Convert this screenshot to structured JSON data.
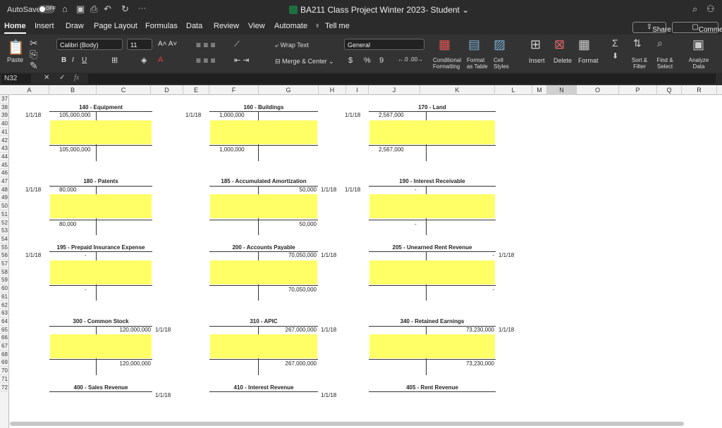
{
  "titlebar": {
    "autosave_label": "AutoSave",
    "autosave_state": "OFF",
    "doc_title": "BA211 Class Project Winter 2023- Student",
    "more": "···"
  },
  "tabs": [
    "Home",
    "Insert",
    "Draw",
    "Page Layout",
    "Formulas",
    "Data",
    "Review",
    "View",
    "Automate"
  ],
  "tell_me": "Tell me",
  "share": "Share",
  "comments": "Comments",
  "ribbon": {
    "paste": "Paste",
    "font": "Calibri (Body)",
    "size": "11",
    "bold": "B",
    "italic": "I",
    "underline": "U",
    "wrap": "Wrap Text",
    "merge": "Merge & Center",
    "number_format": "General",
    "dollar": "$",
    "percent": "%",
    "comma": "9",
    "cond": "Conditional Formatting",
    "format_table": "Format as Table",
    "cell_styles": "Cell Styles",
    "insert": "Insert",
    "delete": "Delete",
    "format": "Format",
    "sort": "Sort & Filter",
    "find": "Find & Select",
    "analyze": "Analyze Data"
  },
  "formula_bar": {
    "name": "N32",
    "fx": "fx",
    "value": ""
  },
  "columns": [
    "A",
    "B",
    "C",
    "D",
    "E",
    "F",
    "G",
    "H",
    "I",
    "J",
    "K",
    "L",
    "M",
    "N",
    "O",
    "P",
    "Q",
    "R"
  ],
  "rows": [
    "37",
    "38",
    "39",
    "40",
    "41",
    "42",
    "43",
    "44",
    "45",
    "46",
    "47",
    "48",
    "49",
    "50",
    "51",
    "52",
    "53",
    "54",
    "55",
    "56",
    "57",
    "58",
    "59",
    "60",
    "61",
    "62",
    "63",
    "64",
    "65",
    "66",
    "67",
    "68",
    "69",
    "70",
    "71",
    "72"
  ],
  "accounts": [
    {
      "title": "140 - Equipment",
      "date_left": "1/1/18",
      "debit": "105,000,000",
      "credit": "",
      "date_right": "",
      "total_left": "105,000,000",
      "total_right": ""
    },
    {
      "title": "160 - Buildings",
      "date_left": "1/1/18",
      "debit": "1,000,000",
      "credit": "",
      "date_right": "",
      "total_left": "1,000,000",
      "total_right": ""
    },
    {
      "title": "170 - Land",
      "date_left": "1/1/18",
      "debit": "2,567,000",
      "credit": "",
      "date_right": "",
      "total_left": "2,567,000",
      "total_right": ""
    },
    {
      "title": "180 - Patents",
      "date_left": "1/1/18",
      "debit": "80,000",
      "credit": "",
      "date_right": "",
      "total_left": "80,000",
      "total_right": ""
    },
    {
      "title": "185 - Accumulated Amortization",
      "date_left": "",
      "debit": "",
      "credit": "50,000",
      "date_right": "1/1/18",
      "total_left": "",
      "total_right": "50,000"
    },
    {
      "title": "190 - Interest Receivable",
      "date_left": "1/1/18",
      "debit": "-",
      "credit": "",
      "date_right": "",
      "total_left": "-",
      "total_right": ""
    },
    {
      "title": "195 - Prepaid Insurance Expense",
      "date_left": "1/1/18",
      "debit": "-",
      "credit": "",
      "date_right": "",
      "total_left": "-",
      "total_right": ""
    },
    {
      "title": "200 - Accounts Payable",
      "date_left": "",
      "debit": "",
      "credit": "70,050,000",
      "date_right": "1/1/18",
      "total_left": "",
      "total_right": "70,050,000"
    },
    {
      "title": "205 - Unearned Rent Revenue",
      "date_left": "",
      "debit": "",
      "credit": "-",
      "date_right": "1/1/18",
      "total_left": "",
      "total_right": "-"
    },
    {
      "title": "300 - Common Stock",
      "date_left": "",
      "debit": "",
      "credit": "120,000,000",
      "date_right": "1/1/18",
      "total_left": "",
      "total_right": "120,000,000"
    },
    {
      "title": "310 - APIC",
      "date_left": "",
      "debit": "",
      "credit": "267,000,000",
      "date_right": "1/1/18",
      "total_left": "",
      "total_right": "267,000,000"
    },
    {
      "title": "340 - Retained Earnings",
      "date_left": "",
      "debit": "",
      "credit": "73,230,000",
      "date_right": "1/1/18",
      "total_left": "",
      "total_right": "73,230,000"
    },
    {
      "title": "400 - Sales Revenue",
      "date_left": "",
      "debit": "",
      "credit": "",
      "date_right": "1/1/18",
      "total_left": "",
      "total_right": ""
    },
    {
      "title": "410 - Interest Revenue",
      "date_left": "",
      "debit": "",
      "credit": "",
      "date_right": "1/1/18",
      "total_left": "",
      "total_right": ""
    },
    {
      "title": "405 - Rent Revenue",
      "date_left": "",
      "debit": "",
      "credit": "",
      "date_right": "",
      "total_left": "",
      "total_right": ""
    }
  ],
  "colors": {
    "yellow": "#ffff66",
    "dark": "#2b2b2b",
    "ribbon": "#333333"
  }
}
